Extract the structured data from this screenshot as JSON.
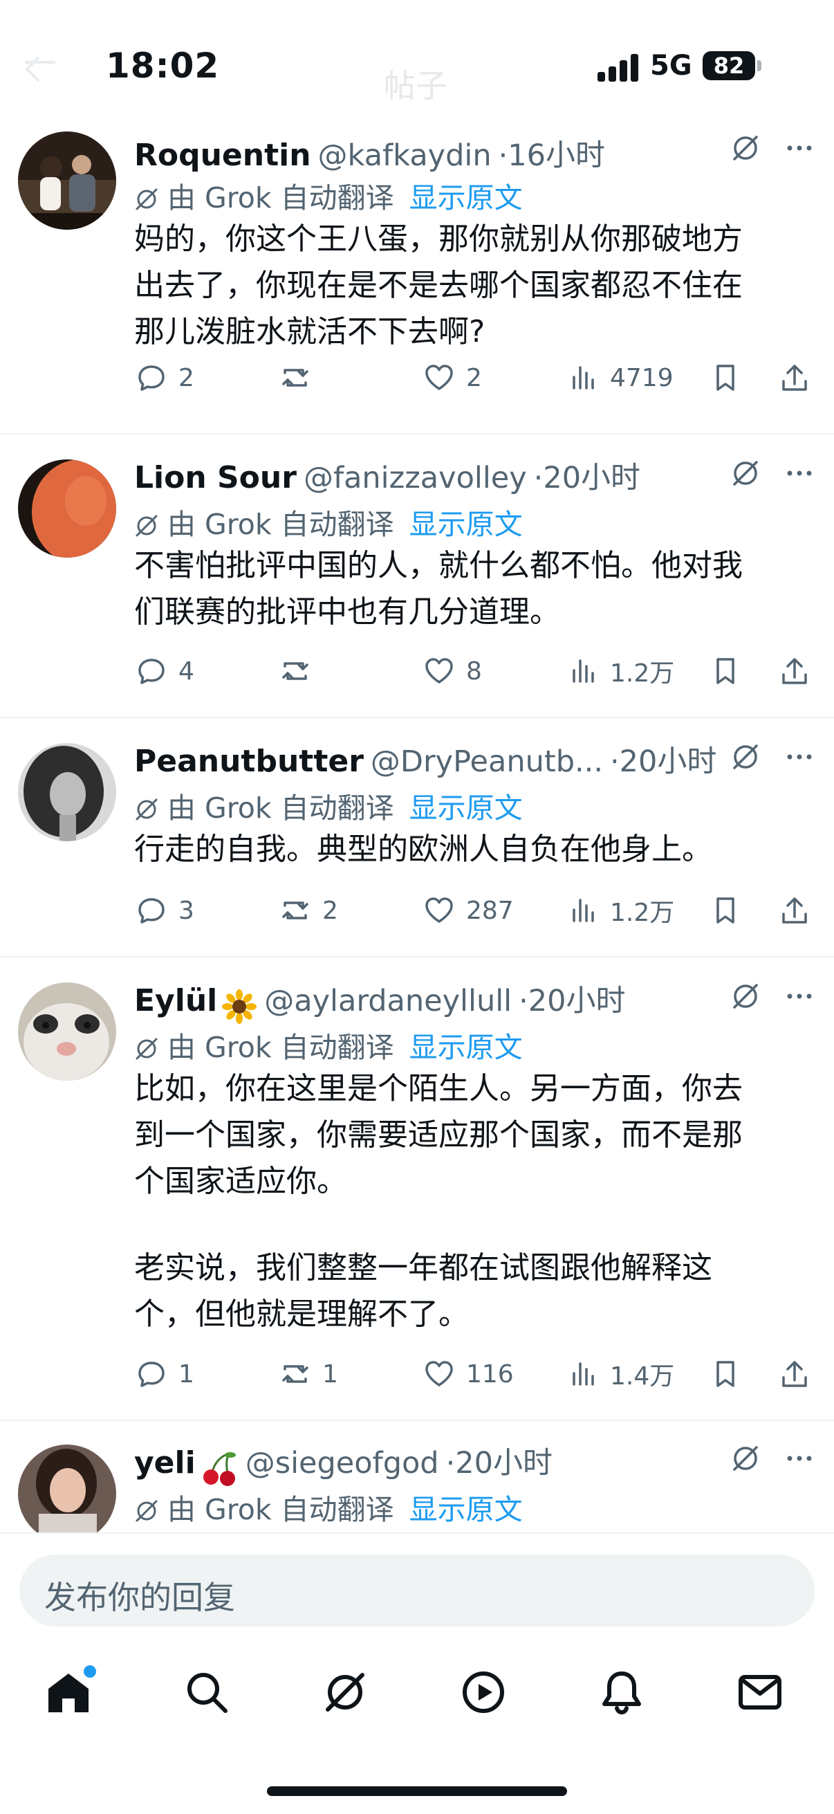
{
  "status": {
    "time": "18:02",
    "network": "5G",
    "battery": "82"
  },
  "header": {
    "title": "帖子"
  },
  "tweets": [
    {
      "name": "Roquentin",
      "emoji": "",
      "handle": "@kafkaydin",
      "time": "16小时",
      "translation": "由 Grok 自动翻译",
      "show_original": "显示原文",
      "text": [
        "妈的，你这个王八蛋，那你就别从你那破地方",
        "出去了，你现在是不是去哪个国家都忍不住在",
        "那儿泼脏水就活不下去啊?"
      ],
      "replies": "2",
      "retweets": "",
      "likes": "2",
      "views": "4719"
    },
    {
      "name": "Lion Sour",
      "emoji": "",
      "handle": "@fanizzavolley",
      "time": "20小时",
      "translation": "由 Grok 自动翻译",
      "show_original": "显示原文",
      "text": [
        "不害怕批评中国的人，就什么都不怕。他对我",
        "们联赛的批评中也有几分道理。"
      ],
      "replies": "4",
      "retweets": "",
      "likes": "8",
      "views": "1.2万"
    },
    {
      "name": "Peanutbutter",
      "emoji": "",
      "handle": "@DryPeanutb...",
      "time": "20小时",
      "translation": "由 Grok 自动翻译",
      "show_original": "显示原文",
      "text": [
        "行走的自我。典型的欧洲人自负在他身上。"
      ],
      "replies": "3",
      "retweets": "2",
      "likes": "287",
      "views": "1.2万"
    },
    {
      "name": "Eylül",
      "emoji": "sunflower",
      "handle": "@aylardaneyllull",
      "time": "20小时",
      "translation": "由 Grok 自动翻译",
      "show_original": "显示原文",
      "text": [
        "比如，你在这里是个陌生人。另一方面，你去",
        "到一个国家，你需要适应那个国家，而不是那",
        "个国家适应你。",
        "",
        "老实说，我们整整一年都在试图跟他解释这",
        "个，但他就是理解不了。"
      ],
      "replies": "1",
      "retweets": "1",
      "likes": "116",
      "views": "1.4万"
    },
    {
      "name": "yeli",
      "emoji": "cherries",
      "handle": "@siegeofgod",
      "time": "20小时",
      "translation": "由 Grok 自动翻译",
      "show_original": "显示原文",
      "text": [],
      "replies": "",
      "retweets": "",
      "likes": "",
      "views": ""
    }
  ],
  "reply_bar": {
    "placeholder": "发布你的回复"
  },
  "tabs": [
    "home-icon",
    "search-icon",
    "grok-icon",
    "video-icon",
    "notifications-icon",
    "messages-icon"
  ],
  "colors": {
    "accent": "#1d9bf0",
    "text": "#0f1419",
    "muted": "#536471",
    "divider": "#eff3f4"
  }
}
